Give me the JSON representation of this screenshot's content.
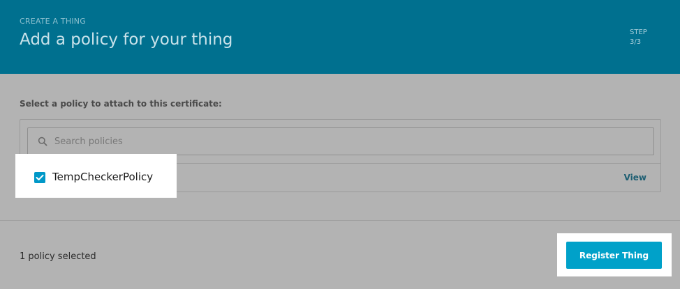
{
  "header": {
    "breadcrumb": "CREATE A THING",
    "title": "Add a policy for your thing",
    "step_label": "STEP",
    "step_value": "3/3"
  },
  "policies": {
    "instruction": "Select a policy to attach to this certificate:",
    "search": {
      "placeholder": "Search policies",
      "value": ""
    },
    "items": [
      {
        "name": "TempCheckerPolicy",
        "checked": true,
        "view_label": "View"
      }
    ]
  },
  "footer": {
    "selected_count": "1 policy selected",
    "register_label": "Register Thing"
  },
  "colors": {
    "header_bg": "#00708f",
    "accent": "#00a1c9",
    "overlay_bg": "#b3b3b3"
  },
  "icons": {
    "search": "search-icon",
    "checkbox": "checkmark-icon"
  }
}
